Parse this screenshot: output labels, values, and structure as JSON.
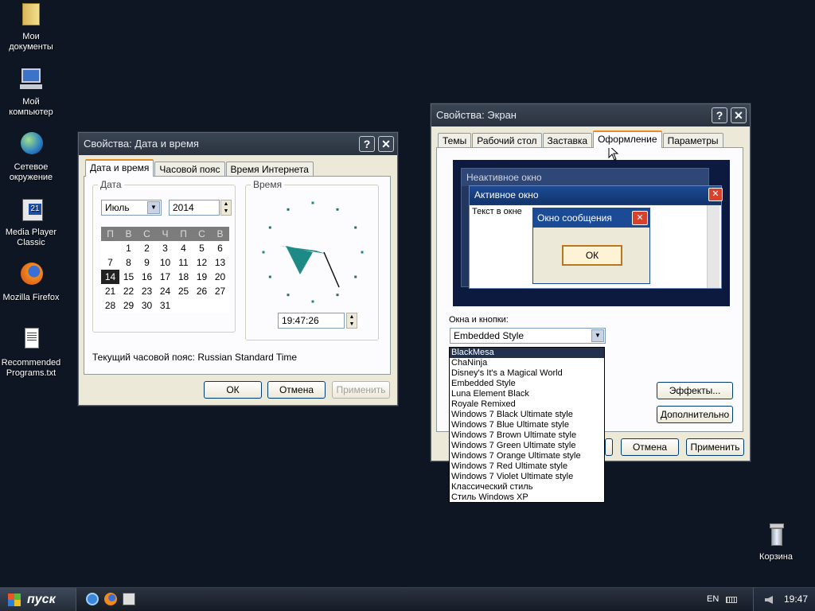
{
  "desktop": {
    "icons": [
      {
        "label": "Мои документы",
        "icon": "folder-icon"
      },
      {
        "label": "Мой компьютер",
        "icon": "computer-icon"
      },
      {
        "label": "Сетевое окружение",
        "icon": "network-globe-icon"
      },
      {
        "label": "Media Player Classic",
        "icon": "media-player-icon"
      },
      {
        "label": "Mozilla Firefox",
        "icon": "firefox-icon"
      },
      {
        "label": "Recommended Programs.txt",
        "icon": "text-file-icon"
      },
      {
        "label": "Корзина",
        "icon": "recycle-bin-icon"
      }
    ]
  },
  "datetime_window": {
    "title": "Свойства: Дата и время",
    "help": "?",
    "close": "✕",
    "tabs": [
      "Дата и время",
      "Часовой пояс",
      "Время Интернета"
    ],
    "date_group": "Дата",
    "time_group": "Время",
    "month": "Июль",
    "year": "2014",
    "weekdays": [
      "П",
      "В",
      "С",
      "Ч",
      "П",
      "С",
      "В"
    ],
    "weeks": [
      [
        "",
        "1",
        "2",
        "3",
        "4",
        "5",
        "6"
      ],
      [
        "7",
        "8",
        "9",
        "10",
        "11",
        "12",
        "13"
      ],
      [
        "14",
        "15",
        "16",
        "17",
        "18",
        "19",
        "20"
      ],
      [
        "21",
        "22",
        "23",
        "24",
        "25",
        "26",
        "27"
      ],
      [
        "28",
        "29",
        "30",
        "31",
        "",
        "",
        ""
      ]
    ],
    "selected_day": "14",
    "time": "19:47:26",
    "timezone_text": "Текущий часовой пояс: Russian Standard Time",
    "ok": "ОК",
    "cancel": "Отмена",
    "apply": "Применить"
  },
  "display_window": {
    "title": "Свойства: Экран",
    "help": "?",
    "close": "✕",
    "tabs": [
      "Темы",
      "Рабочий стол",
      "Заставка",
      "Оформление",
      "Параметры"
    ],
    "preview": {
      "inactive_title": "Неактивное окно",
      "active_title": "Активное окно",
      "body_text": "Текст в окне",
      "msg_title": "Окно сообщения",
      "msg_ok": "ОК"
    },
    "windows_buttons_label": "Окна и кнопки:",
    "selected_style": "Embedded Style",
    "styles": [
      "BlackMesa",
      "ChaNinja",
      "Disney's It's a Magical World",
      "Embedded Style",
      "Luna Element Black",
      "Royale Remixed",
      "Windows 7 Black Ultimate style",
      "Windows 7 Blue Ultimate style",
      "Windows 7 Brown Ultimate style",
      "Windows 7 Green Ultimate style",
      "Windows 7 Orange Ultimate style",
      "Windows 7 Red Ultimate style",
      "Windows 7 Violet Ultimate style",
      "Классический стиль",
      "Стиль Windows XP"
    ],
    "highlighted_style": "BlackMesa",
    "effects": "Эффекты...",
    "advanced": "Дополнительно",
    "cancel": "Отмена",
    "apply": "Применить"
  },
  "taskbar": {
    "start": "пуск",
    "lang": "EN",
    "clock": "19:47"
  },
  "colors": {
    "desktop": "#0e1623",
    "titlebar": "#333c4a",
    "preview_bg": "#0c1a3f",
    "accent_tab": "#e68b2c",
    "close_red": "#d9412c"
  }
}
